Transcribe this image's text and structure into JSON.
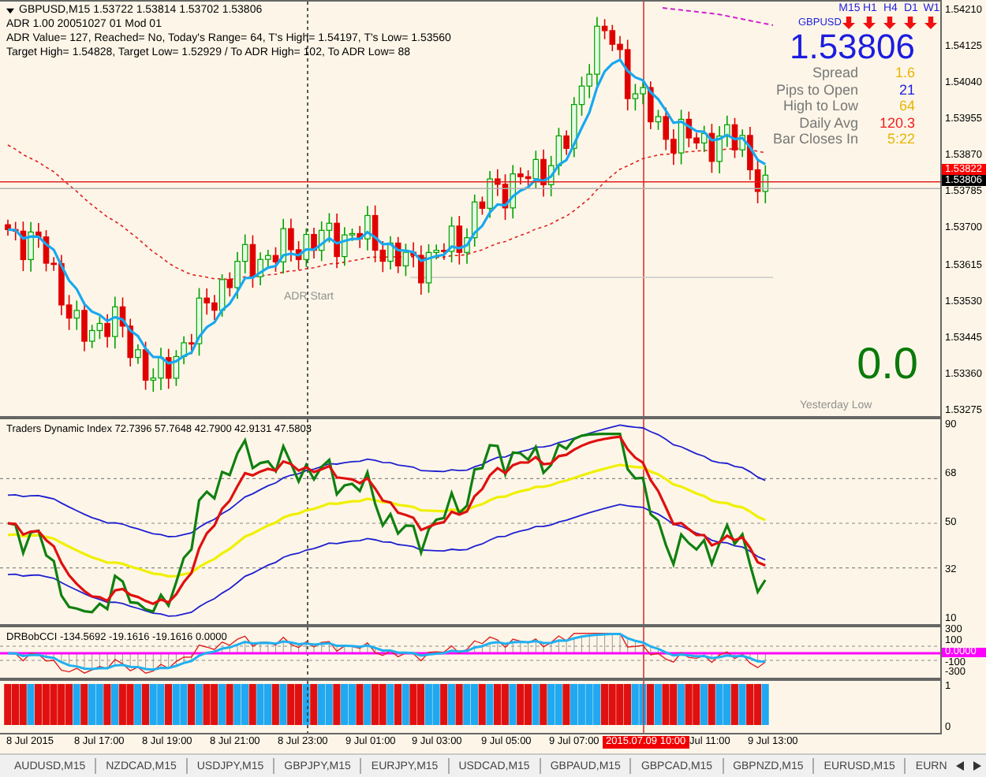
{
  "chart": {
    "symbol_line": "GBPUSD,M15  1.53722 1.53814 1.53702 1.53806",
    "info_lines": [
      "ADR 1.00 20051027 01 Mod 01",
      "ADR Value= 127, Reached= No, Today's Range= 64, T's High= 1.54197, T's Low= 1.53560",
      "Target High= 1.54828, Target Low= 1.52929 / To ADR High= 102, To ADR Low= 88"
    ],
    "adr_start_label": "ADR Start",
    "yesterday_low_label": "Yesterday Low",
    "signal_value": "0.0"
  },
  "info_panel": {
    "symbol": "GBPUSD",
    "price": "1.53806",
    "timeframes": [
      {
        "label": "M15"
      },
      {
        "label": "H1"
      },
      {
        "label": "H4"
      },
      {
        "label": "D1"
      },
      {
        "label": "W1"
      }
    ],
    "rows": [
      {
        "label": "Spread",
        "value": "1.6",
        "color": "#e8b400"
      },
      {
        "label": "Pips to Open",
        "value": "21",
        "color": "#1c1ce0"
      },
      {
        "label": "High to Low",
        "value": "64",
        "color": "#e8b400"
      },
      {
        "label": "Daily Avg",
        "value": "120.3",
        "color": "#f02020"
      },
      {
        "label": "Bar Closes In",
        "value": "5:22",
        "color": "#e8b400"
      }
    ]
  },
  "price_axis": {
    "ticks": [
      "1.54210",
      "1.54125",
      "1.54040",
      "1.53955",
      "1.53870",
      "1.53785",
      "1.53700",
      "1.53615",
      "1.53530",
      "1.53445",
      "1.53360",
      "1.53275"
    ],
    "tags": [
      {
        "text": "1.53822",
        "color": "#ff0000"
      },
      {
        "text": "1.53806",
        "color": "#000000"
      }
    ]
  },
  "tdi": {
    "label": "Traders Dynamic Index 72.7396 57.7648 42.7900 42.9131 47.5803",
    "ticks": [
      "90",
      "68",
      "50",
      "32",
      "10"
    ]
  },
  "cci": {
    "label": "DRBobCCI -134.5692 -19.1616 -19.1616 0.0000",
    "ticks": [
      {
        "text": "300",
        "kind": "plain"
      },
      {
        "text": "100",
        "kind": "plain"
      },
      {
        "text": "0.0000",
        "kind": "tag"
      },
      {
        "text": "-100",
        "kind": "plain"
      },
      {
        "text": "-300",
        "kind": "plain"
      }
    ]
  },
  "bars": {
    "ticks": [
      "1",
      "0"
    ]
  },
  "time_axis": [
    {
      "text": "8 Jul 2015",
      "kind": "plain"
    },
    {
      "text": "8 Jul 17:00",
      "kind": "plain"
    },
    {
      "text": "8 Jul 19:00",
      "kind": "plain"
    },
    {
      "text": "8 Jul 21:00",
      "kind": "plain"
    },
    {
      "text": "8 Jul 23:00",
      "kind": "plain"
    },
    {
      "text": "9 Jul 01:00",
      "kind": "plain"
    },
    {
      "text": "9 Jul 03:00",
      "kind": "plain"
    },
    {
      "text": "9 Jul 05:00",
      "kind": "plain"
    },
    {
      "text": "9 Jul 07:00",
      "kind": "plain"
    },
    {
      "text": "2015.07.09 10:00",
      "kind": "cursor"
    },
    {
      "text": "Jul 11:00",
      "kind": "plain"
    },
    {
      "text": "9 Jul 13:00",
      "kind": "plain"
    }
  ],
  "tabs": [
    {
      "label": "AUDUSD,M15",
      "selected": false
    },
    {
      "label": "NZDCAD,M15",
      "selected": false
    },
    {
      "label": "USDJPY,M15",
      "selected": false
    },
    {
      "label": "GBPJPY,M15",
      "selected": false
    },
    {
      "label": "EURJPY,M15",
      "selected": false
    },
    {
      "label": "USDCAD,M15",
      "selected": false
    },
    {
      "label": "GBPAUD,M15",
      "selected": false
    },
    {
      "label": "GBPCAD,M15",
      "selected": false
    },
    {
      "label": "GBPNZD,M15",
      "selected": false
    },
    {
      "label": "EURUSD,M15",
      "selected": false
    },
    {
      "label": "EURN",
      "selected": false
    }
  ]
}
